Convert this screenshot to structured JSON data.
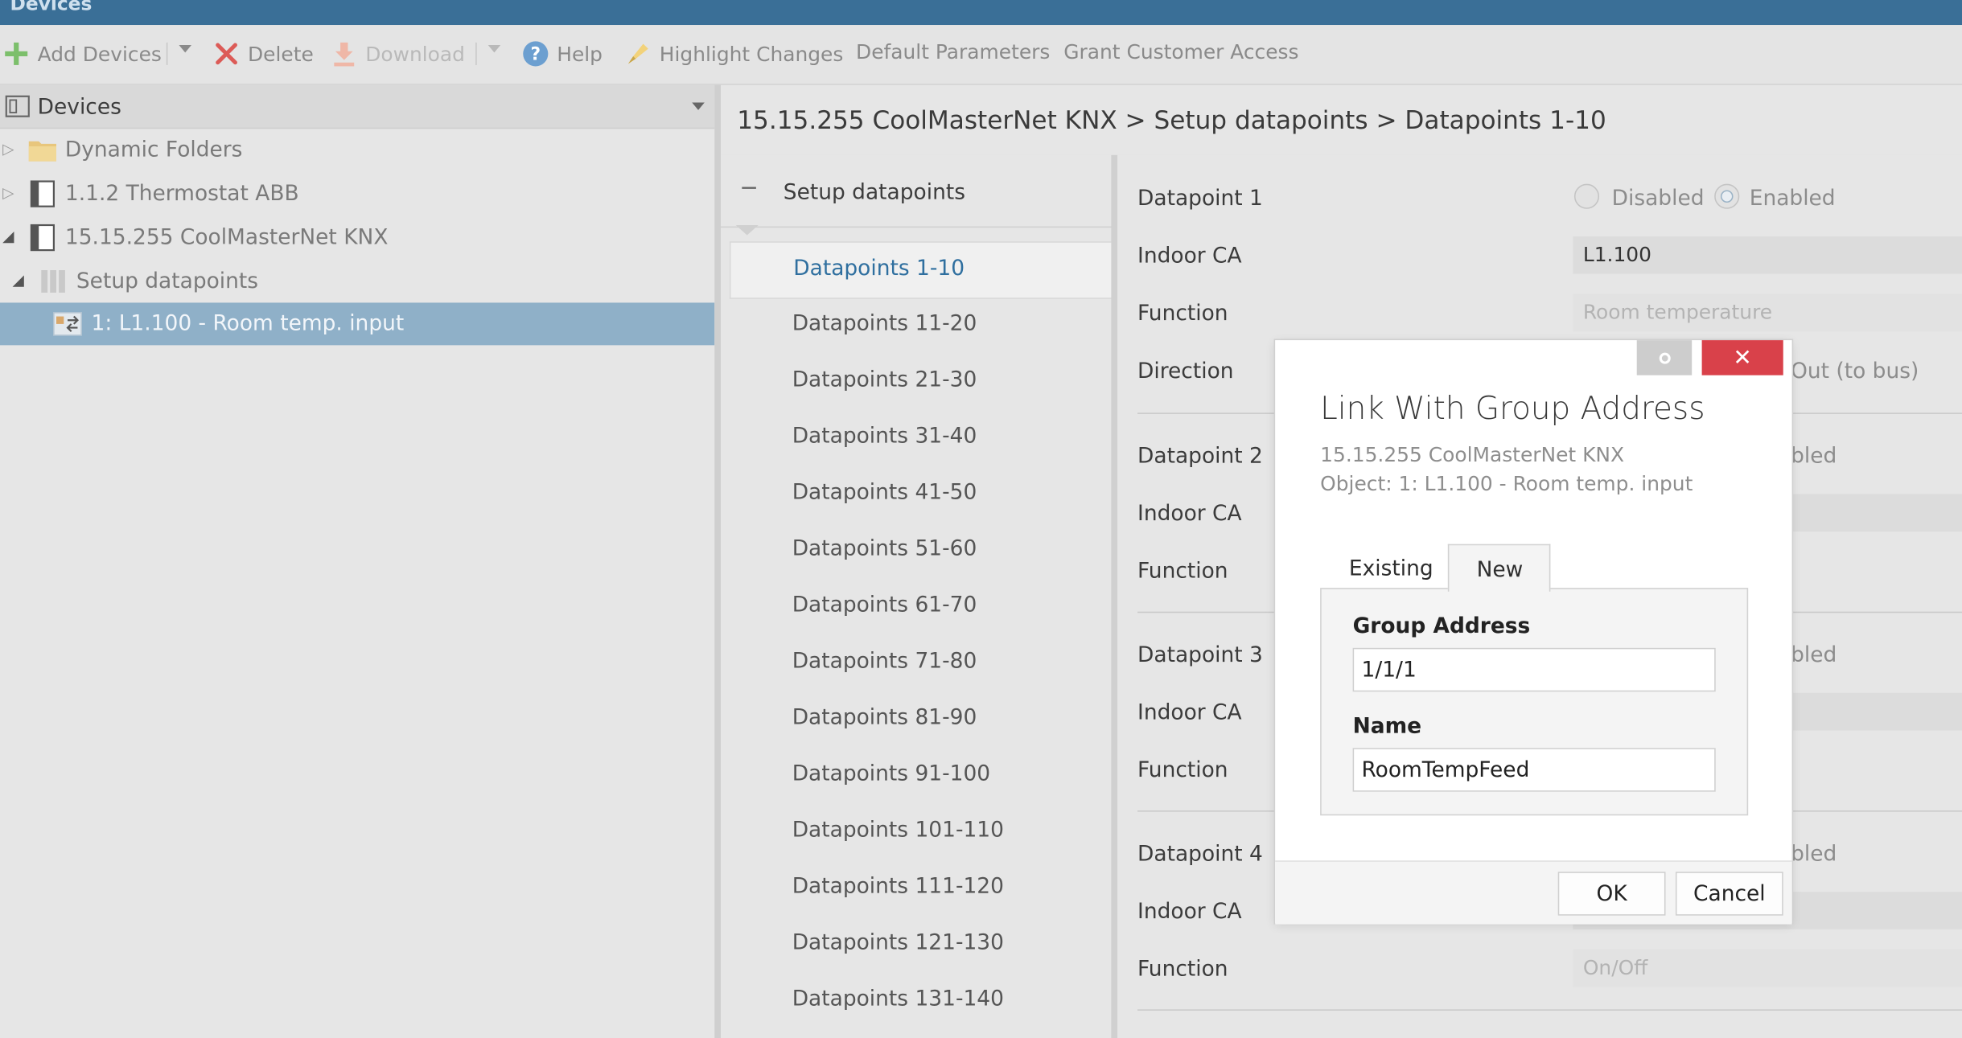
{
  "window": {
    "title": "Devices"
  },
  "toolbar": {
    "add_devices": "Add Devices",
    "delete": "Delete",
    "download": "Download",
    "help": "Help",
    "highlight_changes": "Highlight Changes",
    "default_parameters": "Default Parameters",
    "grant_customer_access": "Grant Customer Access"
  },
  "tree": {
    "header": "Devices",
    "items": [
      {
        "label": "Dynamic Folders"
      },
      {
        "label": "1.1.2 Thermostat ABB"
      },
      {
        "label": "15.15.255 CoolMasterNet KNX"
      },
      {
        "label": "Setup datapoints"
      },
      {
        "label": "1: L1.100 - Room temp. input"
      }
    ]
  },
  "breadcrumb": "15.15.255 CoolMasterNet KNX > Setup datapoints > Datapoints 1-10",
  "subnav": {
    "header": "Setup datapoints",
    "items": [
      "Datapoints 1-10",
      "Datapoints 11-20",
      "Datapoints 21-30",
      "Datapoints 31-40",
      "Datapoints 41-50",
      "Datapoints 51-60",
      "Datapoints 61-70",
      "Datapoints 71-80",
      "Datapoints 81-90",
      "Datapoints 91-100",
      "Datapoints 101-110",
      "Datapoints 111-120",
      "Datapoints 121-130",
      "Datapoints 131-140"
    ]
  },
  "props": {
    "dp1": {
      "label": "Datapoint 1",
      "disabled": "Disabled",
      "enabled": "Enabled",
      "indoor_ca_label": "Indoor CA",
      "indoor_ca_value": "L1.100",
      "function_label": "Function",
      "function_value": "Room temperature",
      "direction_label": "Direction",
      "direction_value": "Out (to bus)"
    },
    "dp2": {
      "label": "Datapoint 2",
      "enabled_partial": "bled",
      "indoor_ca_label": "Indoor CA",
      "function_label": "Function"
    },
    "dp3": {
      "label": "Datapoint 3",
      "enabled_partial": "bled",
      "indoor_ca_label": "Indoor CA",
      "function_label": "Function"
    },
    "dp4": {
      "label": "Datapoint 4",
      "enabled_partial": "bled",
      "indoor_ca_label": "Indoor CA",
      "function_label": "Function",
      "function_value": "On/Off"
    }
  },
  "modal": {
    "title": "Link With Group Address",
    "device": "15.15.255 CoolMasterNet KNX",
    "object": "Object: 1: L1.100 - Room temp. input",
    "tabs": {
      "existing": "Existing",
      "new": "New"
    },
    "group_address_label": "Group Address",
    "group_address_value": "1/1/1",
    "name_label": "Name",
    "name_value": "RoomTempFeed",
    "ok": "OK",
    "cancel": "Cancel"
  }
}
